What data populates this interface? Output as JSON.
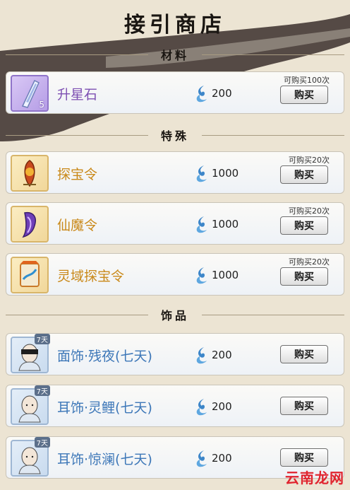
{
  "title": "接引商店",
  "sections": [
    {
      "label": "材料"
    },
    {
      "label": "特殊"
    },
    {
      "label": "饰品"
    }
  ],
  "items": [
    {
      "name": "升星石",
      "price": "200",
      "limit": "可购买100次",
      "buy": "购买",
      "count": "5",
      "icon": "star-stone-icon",
      "color": "#7d4fb2"
    },
    {
      "name": "探宝令",
      "price": "1000",
      "limit": "可购买20次",
      "buy": "购买",
      "icon": "treasure-token-icon",
      "color": "#c9891a"
    },
    {
      "name": "仙魔令",
      "price": "1000",
      "limit": "可购买20次",
      "buy": "购买",
      "icon": "immortal-demon-token-icon",
      "color": "#c9891a"
    },
    {
      "name": "灵域探宝令",
      "price": "1000",
      "limit": "可购买20次",
      "buy": "购买",
      "icon": "spirit-realm-token-icon",
      "color": "#c9891a"
    },
    {
      "name": "面饰·残夜(七天)",
      "price": "200",
      "buy": "购买",
      "tag": "7天",
      "icon": "masked-face-avatar-icon",
      "color": "#3d77b8"
    },
    {
      "name": "耳饰·灵鲤(七天)",
      "price": "200",
      "buy": "购买",
      "tag": "7天",
      "icon": "bald-face-avatar-icon",
      "color": "#3d77b8"
    },
    {
      "name": "耳饰·惊澜(七天)",
      "price": "200",
      "buy": "购买",
      "tag": "7天",
      "icon": "bald-face-avatar-icon",
      "color": "#3d77b8"
    }
  ],
  "currency_icon": "spirit-flame-icon",
  "watermark": "云南龙网"
}
